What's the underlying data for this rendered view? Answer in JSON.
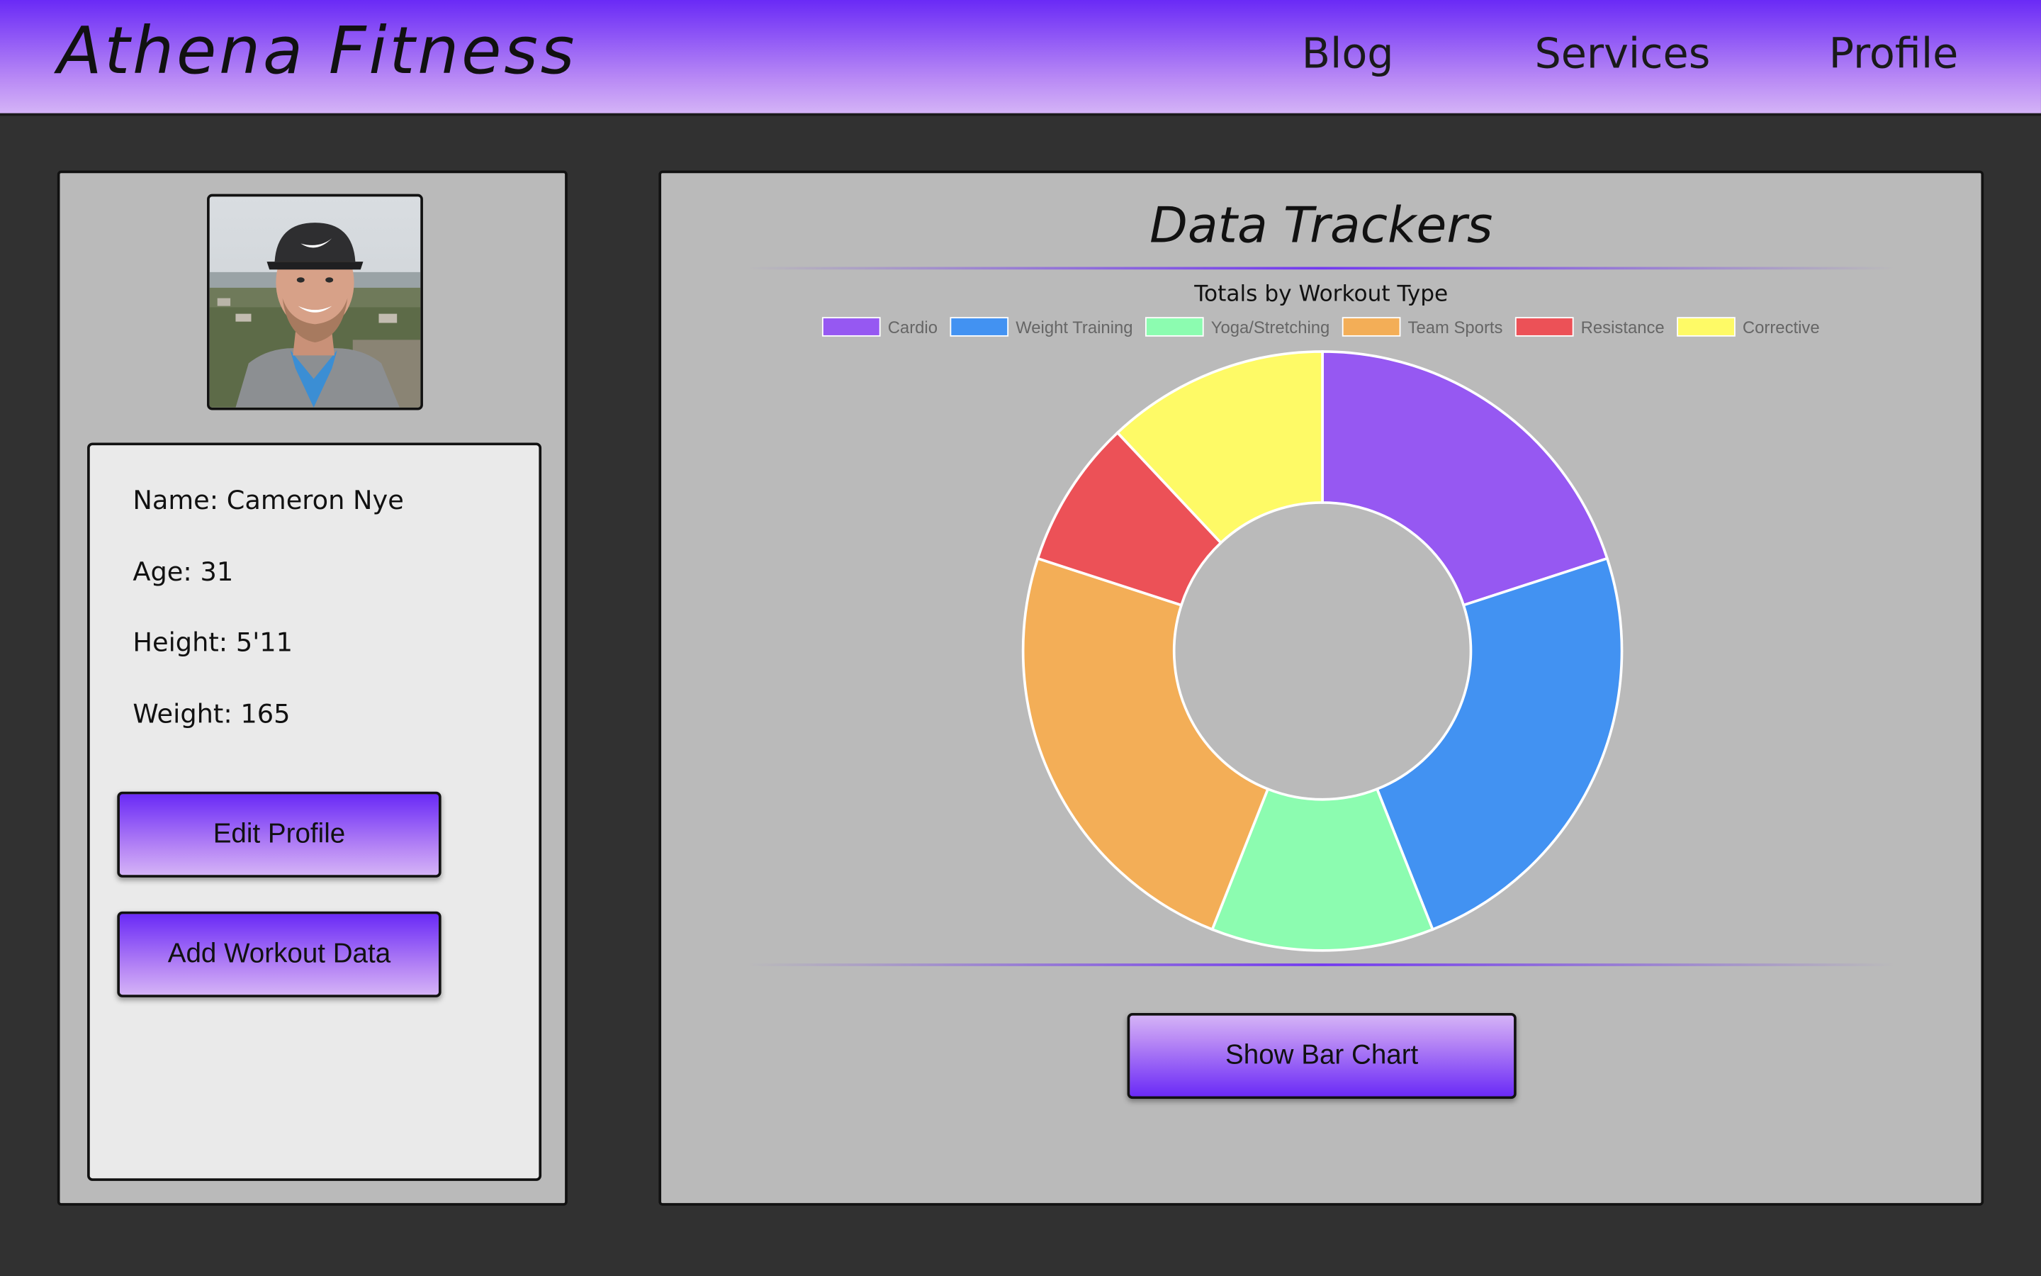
{
  "navbar": {
    "brand": "Athena Fitness",
    "links": [
      "Blog",
      "Services",
      "Profile"
    ]
  },
  "profile": {
    "name_line": "Name: Cameron Nye",
    "age_line": "Age: 31",
    "height_line": "Height: 5'11",
    "weight_line": "Weight: 165",
    "edit_button": "Edit Profile",
    "add_workout_button": "Add Workout Data"
  },
  "trackers": {
    "section_title": "Data Trackers",
    "toggle_button": "Show Bar Chart"
  },
  "colors": {
    "accent": "#6a2af6",
    "accent_light": "#d4b3f7",
    "panel": "#bababa",
    "card": "#eaeaea",
    "page_background": "#313131"
  },
  "chart_data": {
    "type": "pie",
    "variant": "doughnut",
    "title": "Totals by Workout Type",
    "legend_position": "top",
    "categories": [
      "Cardio",
      "Weight Training",
      "Yoga/Stretching",
      "Team Sports",
      "Resistance",
      "Corrective"
    ],
    "values": [
      20,
      24,
      12,
      24,
      8,
      12
    ],
    "colors": [
      "#9658f2",
      "#4292f2",
      "#8cfcb0",
      "#f3ae57",
      "#ec5157",
      "#fefa66"
    ]
  }
}
